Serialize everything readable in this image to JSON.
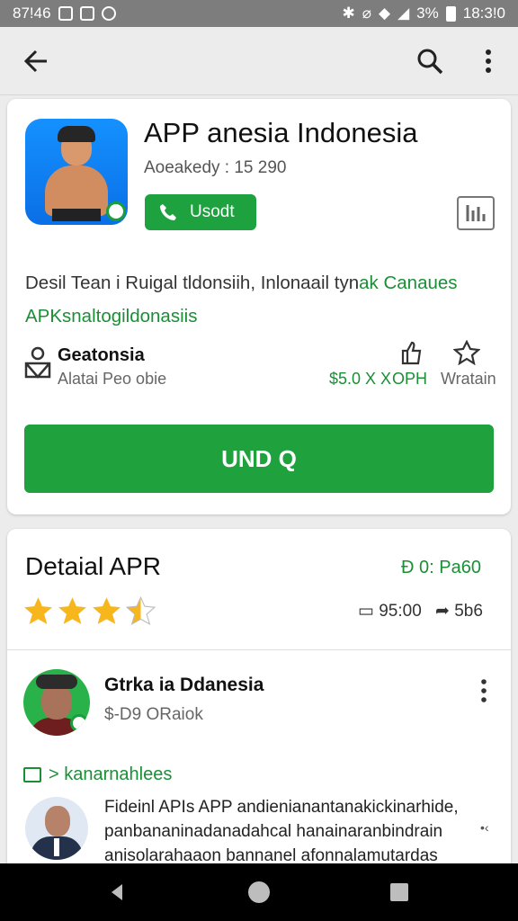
{
  "status_bar": {
    "time_left": "87!46",
    "battery_pct": "3%",
    "time_right": "18:3!0"
  },
  "app_bar": {
    "back_icon": "arrow-left-icon",
    "search_icon": "search-icon",
    "more_icon": "more-vert-icon"
  },
  "app": {
    "title": "APP anesia Indonesia",
    "subtitle": "Aoeakedy : 15 290",
    "call_label": "Usodt",
    "description_plain": "Desil Tean i Ruigal tldonsiih, Inlonaail tyn",
    "description_green1": "ak Canaues",
    "description_green2": "APKsnaltogildonasiis",
    "developer": "Geatonsia",
    "developer_sub": "Alatai Peo obie",
    "price": "$5.0 X X",
    "price2": "OPH",
    "meta3": "Wratain",
    "install_label": "UND Q"
  },
  "details": {
    "title": "Detaial APR",
    "right_label": "0: Pa60",
    "rating": 3.5,
    "comments": "95:00",
    "shares": "5b6",
    "comment": {
      "user": "Gtrka ia Ddanesia",
      "sub": "$-D9 ORaiok"
    },
    "section": "> kanarnahlees",
    "post": "Fideinl APIs APP andienianantanakickinarhide, panbananinadanadahcal hanainaranbindrain anisolarahaaon bannanel afonnalamutardas"
  },
  "colors": {
    "accent": "#1fa13e",
    "status_bar": "#7d7d7d",
    "star": "#f7b61c"
  }
}
